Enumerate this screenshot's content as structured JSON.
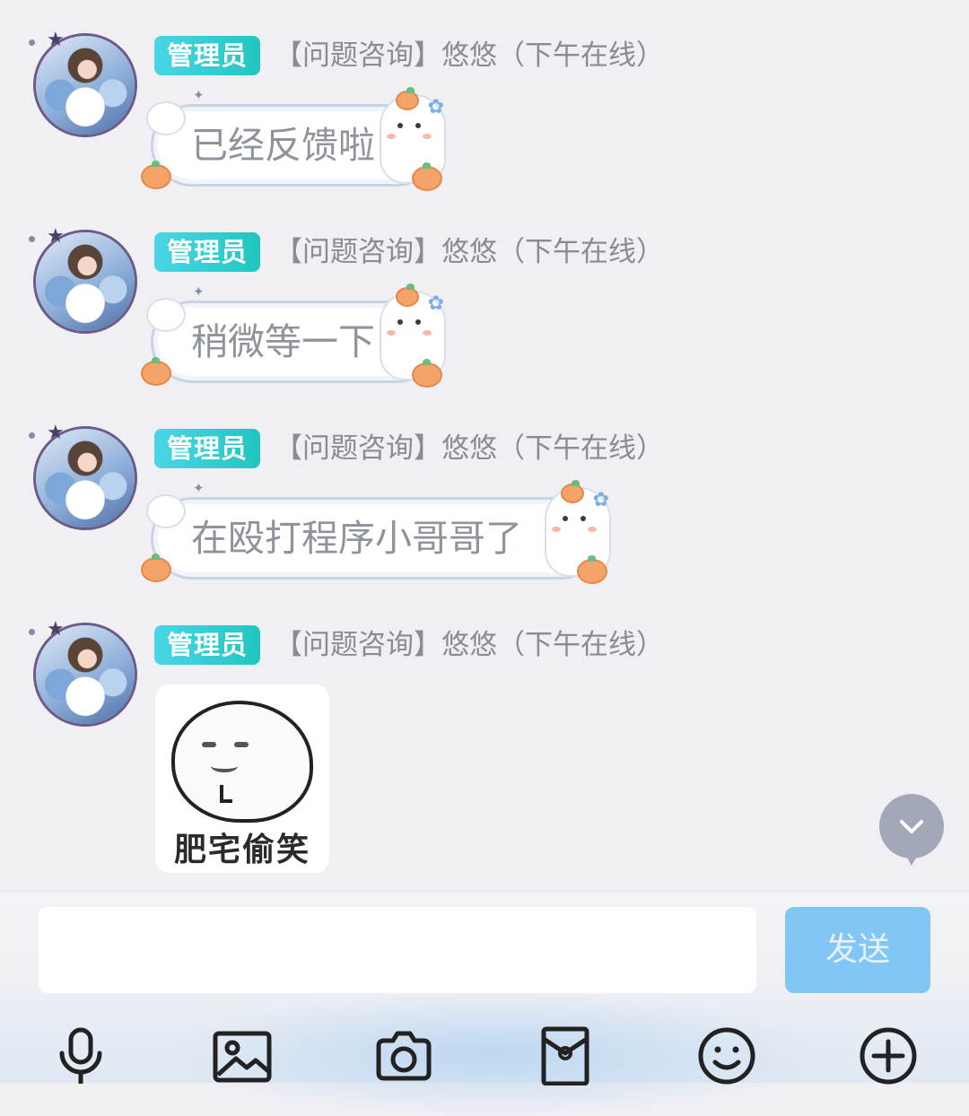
{
  "messages": [
    {
      "role_badge": "管理员",
      "sender": "【问题咨询】悠悠（下午在线）",
      "text": "已经反馈啦"
    },
    {
      "role_badge": "管理员",
      "sender": "【问题咨询】悠悠（下午在线）",
      "text": "稍微等一下"
    },
    {
      "role_badge": "管理员",
      "sender": "【问题咨询】悠悠（下午在线）",
      "text": "在殴打程序小哥哥了"
    },
    {
      "role_badge": "管理员",
      "sender": "【问题咨询】悠悠（下午在线）",
      "sticker_caption": "肥宅偷笑"
    }
  ],
  "scroll_button": {
    "icon": "chevron-down-icon"
  },
  "composer": {
    "input_value": "",
    "input_placeholder": "",
    "send_label": "发送"
  },
  "toolbar": [
    {
      "name": "voice",
      "icon": "microphone-icon"
    },
    {
      "name": "image",
      "icon": "image-icon"
    },
    {
      "name": "camera",
      "icon": "camera-icon"
    },
    {
      "name": "red-packet",
      "icon": "red-packet-icon"
    },
    {
      "name": "emoji",
      "icon": "smiley-icon"
    },
    {
      "name": "more",
      "icon": "plus-circle-icon"
    }
  ],
  "colors": {
    "background": "#efeff4",
    "badge_start": "#49d6e6",
    "badge_end": "#21c6bf",
    "send_button": "#82c6f6",
    "bubble_text": "#8e939c"
  }
}
